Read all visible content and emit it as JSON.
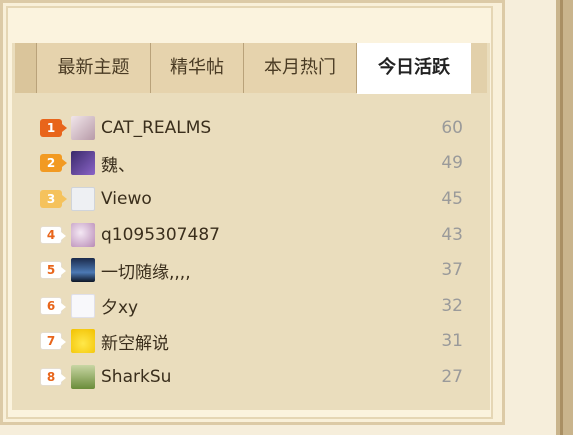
{
  "tabs": {
    "items": [
      {
        "label": "最新主题"
      },
      {
        "label": "精华帖"
      },
      {
        "label": "本月热门"
      },
      {
        "label": "今日活跃"
      }
    ],
    "active": "今日活跃"
  },
  "ranking": [
    {
      "rank": "1",
      "name": "CAT_REALMS",
      "score": "60"
    },
    {
      "rank": "2",
      "name": "魏、",
      "score": "49"
    },
    {
      "rank": "3",
      "name": "Viewo",
      "score": "45"
    },
    {
      "rank": "4",
      "name": "q1095307487",
      "score": "43"
    },
    {
      "rank": "5",
      "name": "一切随缘,,,,",
      "score": "37"
    },
    {
      "rank": "6",
      "name": "夕xy",
      "score": "32"
    },
    {
      "rank": "7",
      "name": "新空解说",
      "score": "31"
    },
    {
      "rank": "8",
      "name": "SharkSu",
      "score": "27"
    }
  ]
}
